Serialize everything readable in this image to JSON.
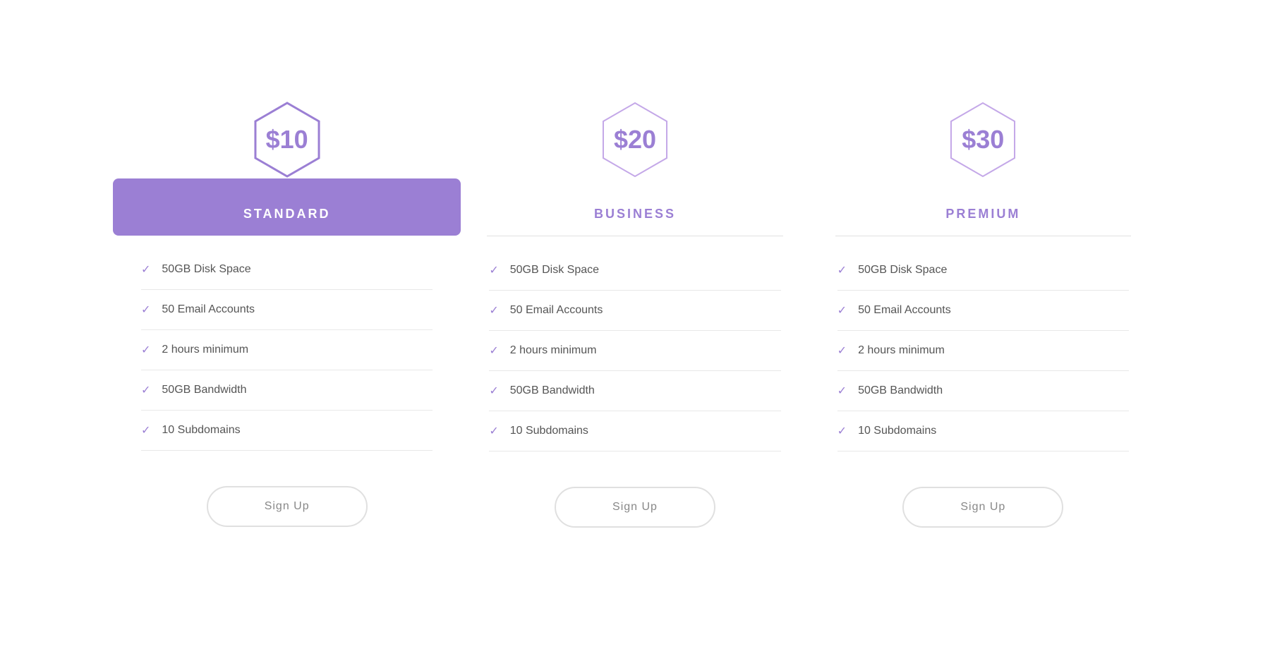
{
  "plans": [
    {
      "id": "standard",
      "price": "$10",
      "name": "STANDARD",
      "active": true,
      "features": [
        "50GB Disk Space",
        "50 Email Accounts",
        "2 hours minimum",
        "50GB Bandwidth",
        "10 Subdomains"
      ],
      "cta": "Sign Up"
    },
    {
      "id": "business",
      "price": "$20",
      "name": "BUSINESS",
      "active": false,
      "features": [
        "50GB Disk Space",
        "50 Email Accounts",
        "2 hours minimum",
        "50GB Bandwidth",
        "10 Subdomains"
      ],
      "cta": "Sign Up"
    },
    {
      "id": "premium",
      "price": "$30",
      "name": "PREMIUM",
      "active": false,
      "features": [
        "50GB Disk Space",
        "50 Email Accounts",
        "2 hours minimum",
        "50GB Bandwidth",
        "10 Subdomains"
      ],
      "cta": "Sign Up"
    }
  ],
  "check_symbol": "✓"
}
